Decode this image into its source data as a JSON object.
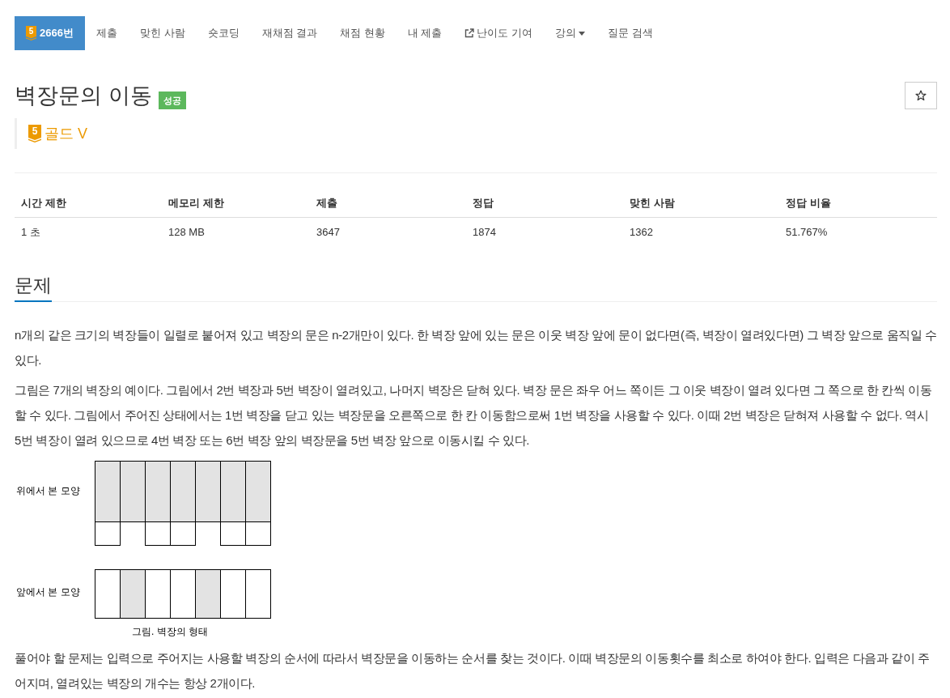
{
  "nav": [
    {
      "label": "2666번",
      "kind": "problem",
      "badge": "5",
      "selected": true
    },
    {
      "label": "제출",
      "kind": "link",
      "selected": false
    },
    {
      "label": "맞힌 사람",
      "kind": "link",
      "selected": false
    },
    {
      "label": "숏코딩",
      "kind": "link",
      "selected": false
    },
    {
      "label": "재채점 결과",
      "kind": "link",
      "selected": false
    },
    {
      "label": "채점 현황",
      "kind": "link",
      "selected": false
    },
    {
      "label": "내 제출",
      "kind": "link",
      "selected": false
    },
    {
      "label": "난이도 기여",
      "kind": "external",
      "selected": false
    },
    {
      "label": "강의",
      "kind": "dropdown",
      "selected": false
    },
    {
      "label": "질문 검색",
      "kind": "link",
      "selected": false
    }
  ],
  "problem": {
    "title": "벽장문의 이동",
    "result_badge": "성공",
    "tier": {
      "badge": "5",
      "name": "골드 V"
    }
  },
  "favorite_button": {
    "starred": false
  },
  "info_table": {
    "columns": [
      "시간 제한",
      "메모리 제한",
      "제출",
      "정답",
      "맞힌 사람",
      "정답 비율"
    ],
    "rows": [
      [
        "1 초",
        "128 MB",
        "3647",
        "1874",
        "1362",
        "51.767%"
      ]
    ]
  },
  "problem_section": {
    "heading": "문제",
    "content": [
      {
        "kind": "paragraph",
        "text": "n개의 같은 크기의 벽장들이 일렬로 붙어져 있고 벽장의 문은 n-2개만이 있다. 한 벽장 앞에 있는 문은 이웃 벽장 앞에 문이 없다면(즉, 벽장이 열려있다면) 그 벽장 앞으로 움직일 수 있다."
      },
      {
        "kind": "paragraph",
        "text": "그림은 7개의 벽장의 예이다. 그림에서 2번 벽장과 5번 벽장이 열려있고, 나머지 벽장은 닫혀 있다. 벽장 문은 좌우 어느 쪽이든 그 이웃 벽장이 열려 있다면 그 쪽으로 한 칸씩 이동할 수 있다. 그림에서 주어진 상태에서는 1번 벽장을 닫고 있는 벽장문을 오른쪽으로 한 칸 이동함으로써 1번 벽장을 사용할 수 있다. 이때 2번 벽장은 닫혀져 사용할 수 없다. 역시 5번 벽장이 열려 있으므로 4번 벽장 또는 6번 벽장 앞의 벽장문을 5번 벽장 앞으로 이동시킬 수 있다."
      },
      {
        "kind": "figure",
        "top_view_label": "위에서 본 모양",
        "front_view_label": "앞에서 본 모양",
        "caption": "그림. 벽장의 형태",
        "closets": [
          {
            "open": false
          },
          {
            "open": true
          },
          {
            "open": false
          },
          {
            "open": false
          },
          {
            "open": true
          },
          {
            "open": false
          },
          {
            "open": false
          }
        ]
      },
      {
        "kind": "paragraph",
        "text": "풀어야 할 문제는 입력으로 주어지는 사용할 벽장의 순서에 따라서 벽장문을 이동하는 순서를 찾는 것이다. 이때 벽장문의 이동횟수를 최소로 하여야 한다. 입력은 다음과 같이 주어지며, 열려있는 벽장의 개수는 항상 2개이다."
      }
    ]
  }
}
